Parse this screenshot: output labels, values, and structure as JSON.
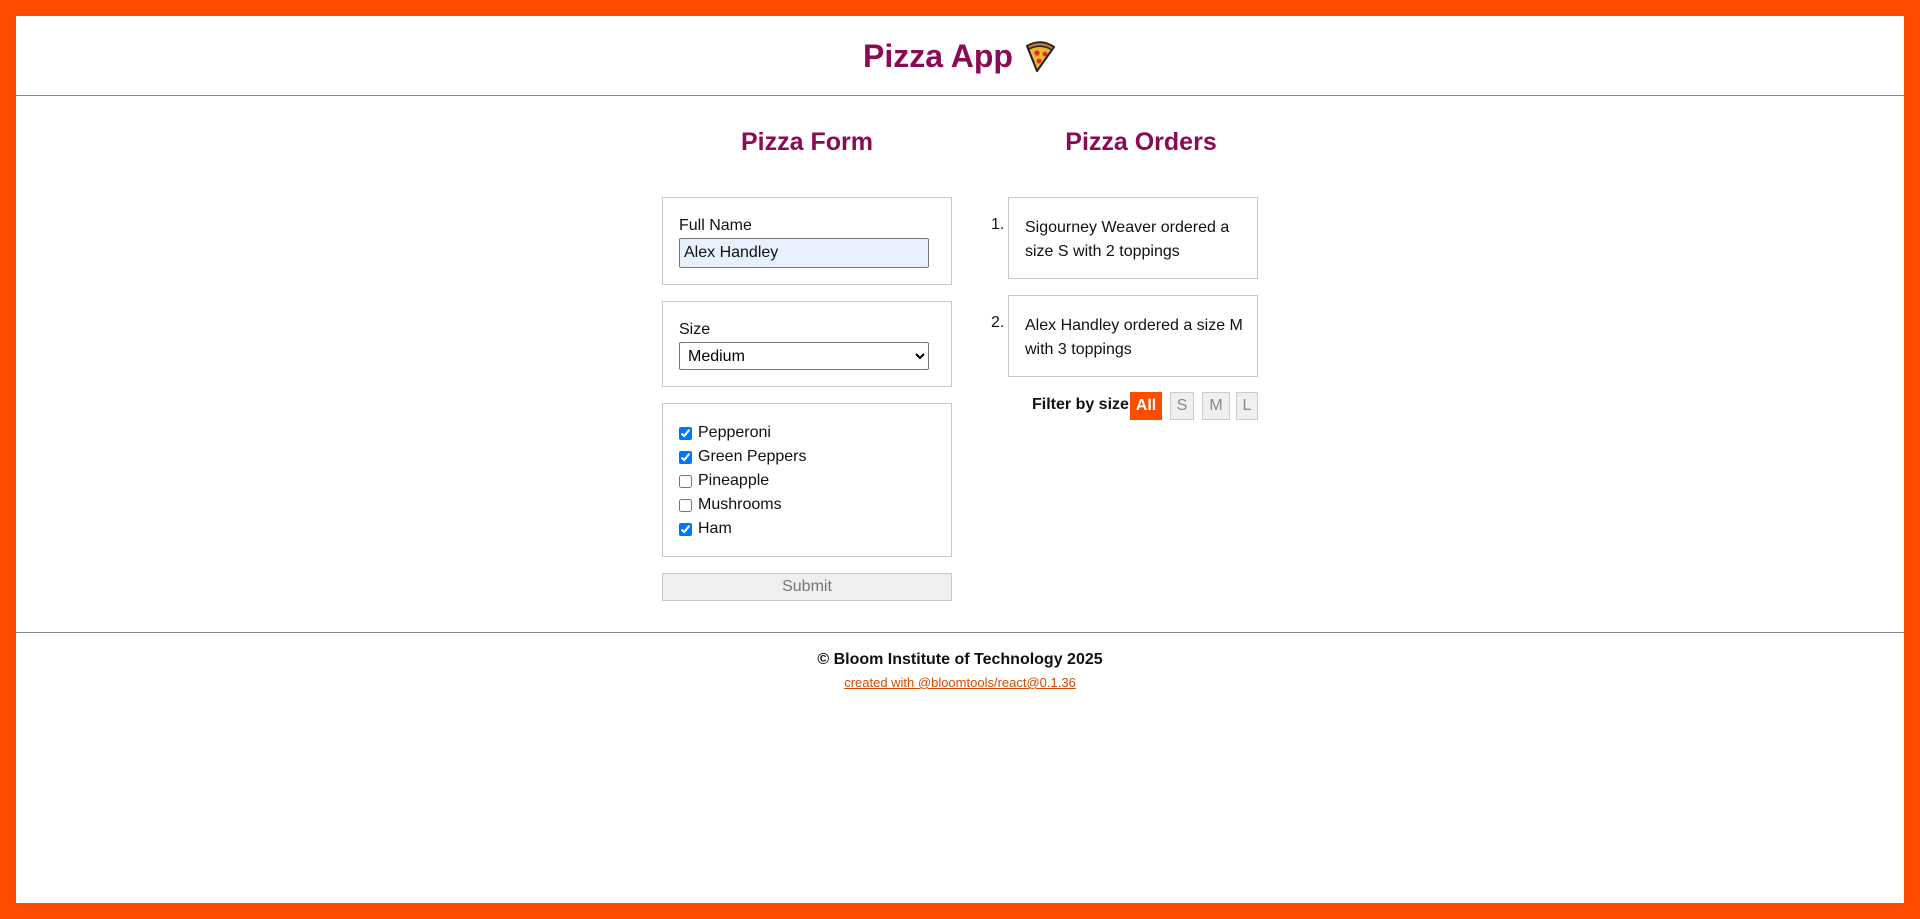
{
  "header": {
    "title": "Pizza App",
    "icon": "pizza-icon"
  },
  "form": {
    "title": "Pizza Form",
    "full_name_label": "Full Name",
    "full_name_value": "Alex Handley",
    "size_label": "Size",
    "size_selected": "Medium",
    "toppings": [
      {
        "label": "Pepperoni",
        "checked": true
      },
      {
        "label": "Green Peppers",
        "checked": true
      },
      {
        "label": "Pineapple",
        "checked": false
      },
      {
        "label": "Mushrooms",
        "checked": false
      },
      {
        "label": "Ham",
        "checked": true
      }
    ],
    "submit_label": "Submit"
  },
  "orders": {
    "title": "Pizza Orders",
    "items": [
      {
        "number": "1.",
        "text": "Sigourney Weaver ordered a size S with 2 toppings"
      },
      {
        "number": "2.",
        "text": "Alex Handley ordered a size M with 3 toppings"
      }
    ],
    "filter_label": "Filter by size:",
    "filters": [
      "All",
      "S",
      "M",
      "L"
    ],
    "active_filter": "All"
  },
  "footer": {
    "copyright": "© Bloom Institute of Technology 2025",
    "credit_link": "created with @bloomtools/react@0.1.36"
  },
  "colors": {
    "accent": "#ff4d00",
    "title": "#8b0a55",
    "input_bg": "#e8f0fe"
  }
}
